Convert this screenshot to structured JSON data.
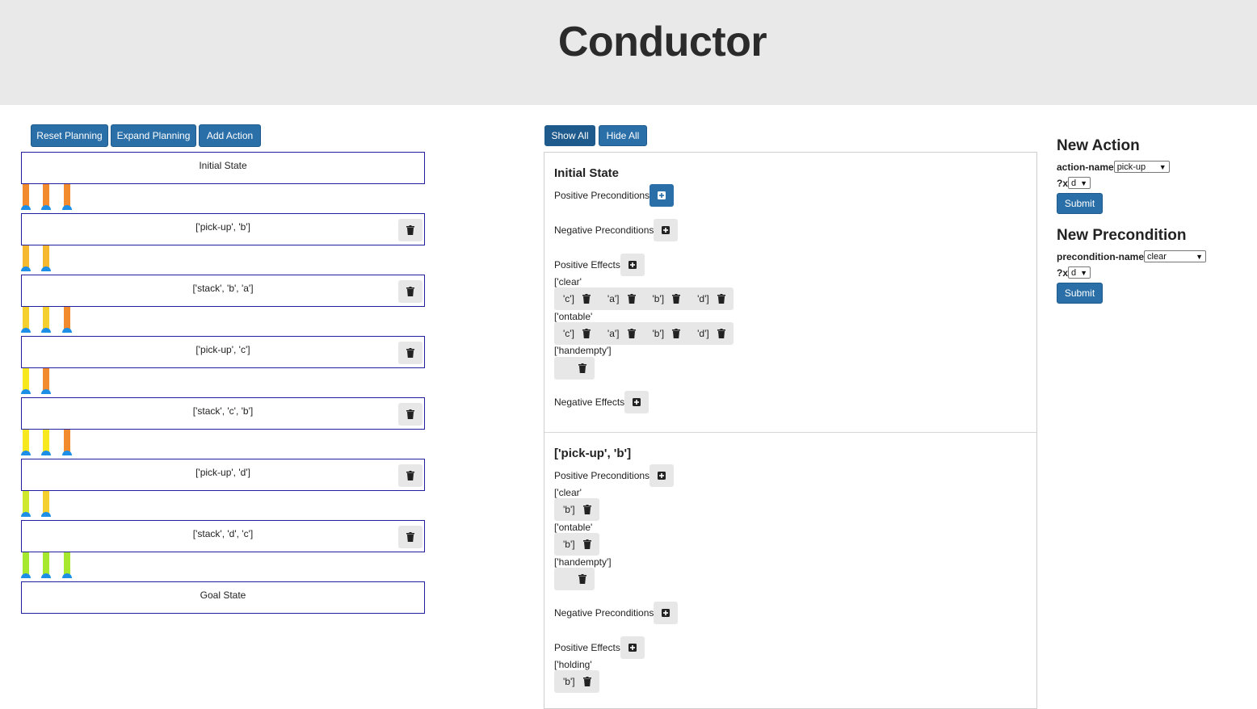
{
  "app": {
    "title": "Conductor"
  },
  "left_toolbar": {
    "reset_label": "Reset Planning",
    "expand_label": "Expand Planning",
    "add_label": "Add Action"
  },
  "chain": {
    "initial": "Initial State",
    "actions": [
      "['pick-up', 'b']",
      "['stack', 'b', 'a']",
      "['pick-up', 'c']",
      "['stack', 'c', 'b']",
      "['pick-up', 'd']",
      "['stack', 'd', 'c']"
    ],
    "goal": "Goal State"
  },
  "connector_colors": {
    "orange": "#f28b2e",
    "amber": "#f5b82e",
    "yellow": "#f7e81f",
    "lime": "#cfe82e",
    "green": "#a6e82e",
    "dot": "#1e8fe6"
  },
  "mid_toolbar": {
    "show_all_label": "Show All",
    "hide_all_label": "Hide All"
  },
  "detail": {
    "sections": [
      {
        "title": "Initial State",
        "pos_pre_label": "Positive Preconditions",
        "neg_pre_label": "Negative Preconditions",
        "pos_eff_label": "Positive Effects",
        "pos_eff": [
          {
            "pred": "['clear'",
            "args": [
              "'c']",
              "'a']",
              "'b']",
              "'d']"
            ]
          },
          {
            "pred": "['ontable'",
            "args": [
              "'c']",
              "'a']",
              "'b']",
              "'d']"
            ]
          },
          {
            "pred": "['handempty']",
            "args": [
              ""
            ]
          }
        ],
        "neg_eff_label": "Negative Effects"
      },
      {
        "title": "['pick-up', 'b']",
        "pos_pre_label": "Positive Preconditions",
        "pos_pre": [
          {
            "pred": "['clear'",
            "args": [
              "'b']"
            ]
          },
          {
            "pred": "['ontable'",
            "args": [
              "'b']"
            ]
          },
          {
            "pred": "['handempty']",
            "args": [
              ""
            ]
          }
        ],
        "neg_pre_label": "Negative Preconditions",
        "pos_eff_label": "Positive Effects",
        "pos_eff": [
          {
            "pred": "['holding'",
            "args": [
              "'b']"
            ]
          }
        ]
      }
    ]
  },
  "new_action": {
    "heading": "New Action",
    "name_label": "action-name",
    "name_value": "pick-up",
    "param_label": "?x",
    "param_value": "d",
    "submit_label": "Submit"
  },
  "new_precondition": {
    "heading": "New Precondition",
    "name_label": "precondition-name",
    "name_value": "clear",
    "param_label": "?x",
    "param_value": "d",
    "submit_label": "Submit"
  }
}
